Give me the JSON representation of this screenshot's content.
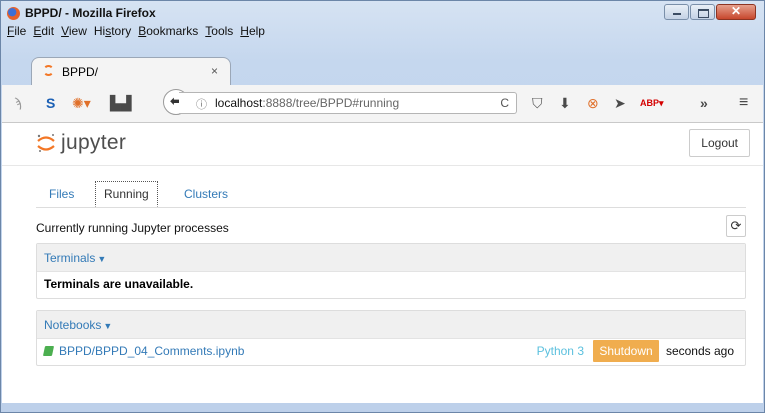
{
  "window": {
    "title": "BPPD/ - Mozilla Firefox"
  },
  "menu": [
    "File",
    "Edit",
    "View",
    "History",
    "Bookmarks",
    "Tools",
    "Help"
  ],
  "browser_tab": {
    "label": "BPPD/",
    "close": "×"
  },
  "urlbar": {
    "host": "localhost",
    "rest": ":8888/tree/BPPD#running"
  },
  "jupyter": {
    "logo_text": "jupyter",
    "logout_label": "Logout",
    "tabs": [
      {
        "label": "Files",
        "active": false
      },
      {
        "label": "Running",
        "active": true
      },
      {
        "label": "Clusters",
        "active": false
      }
    ],
    "running_desc": "Currently running Jupyter processes",
    "terminals": {
      "header": "Terminals",
      "message": "Terminals are unavailable."
    },
    "notebooks": {
      "header": "Notebooks",
      "items": [
        {
          "name": "BPPD/BPPD_04_Comments.ipynb",
          "kernel": "Python 3",
          "action": "Shutdown",
          "last_activity": "seconds ago"
        }
      ]
    }
  },
  "colors": {
    "link_blue": "#337ab7",
    "kernel_cyan": "#5bc0de",
    "shutdown_orange": "#f0ad4e",
    "jupyter_orange": "#f37726"
  },
  "icons": [
    "firefox-logo",
    "rss-icon",
    "s-icon",
    "bug-icon",
    "printer-icon",
    "back-arrow-icon",
    "info-icon",
    "reload-icon",
    "pocket-icon",
    "download-icon",
    "blocked-icon",
    "send-icon",
    "abp-icon",
    "overflow-icon",
    "hamburger-menu-icon",
    "refresh-icon",
    "notebook-icon"
  ]
}
